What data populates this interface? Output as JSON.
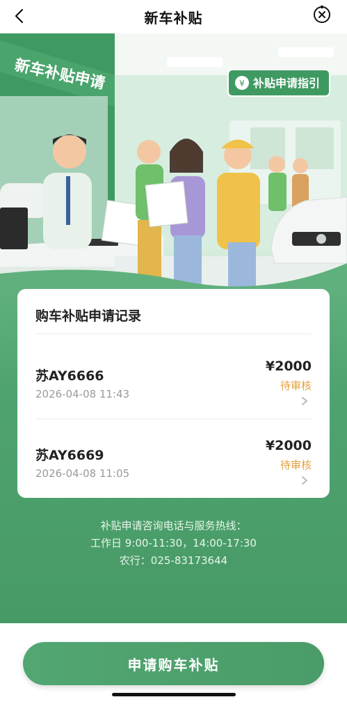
{
  "header": {
    "title": "新车补贴"
  },
  "hero": {
    "sign_counter": "新车补贴申请",
    "sign_guide": "补贴申请指引"
  },
  "records": {
    "title": "购车补贴申请记录",
    "items": [
      {
        "plate": "苏AY6666",
        "time": "2026-04-08 11:43",
        "amount": "¥2000",
        "status": "待审核"
      },
      {
        "plate": "苏AY6669",
        "time": "2026-04-08 11:05",
        "amount": "¥2000",
        "status": "待审核"
      }
    ]
  },
  "hotline": {
    "line1": "补贴申请咨询电话与服务热线：",
    "line2": "工作日 9:00-11:30，14:00-17:30",
    "line3": "农行：025-83173644"
  },
  "action": {
    "apply_label": "申请购车补贴"
  },
  "colors": {
    "brand_green": "#4fa36e",
    "status_orange": "#e3a13c"
  }
}
